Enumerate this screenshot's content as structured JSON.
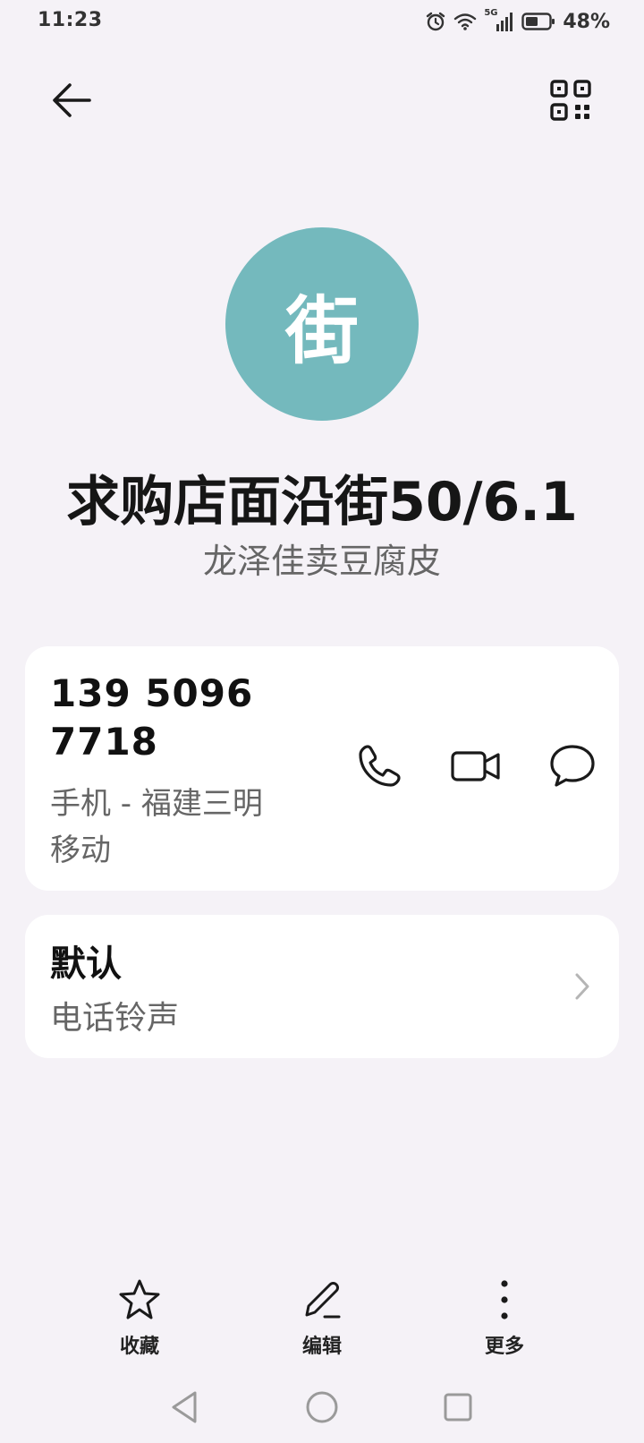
{
  "status_bar": {
    "time": "11:23",
    "network": "5G",
    "battery": "48%"
  },
  "contact": {
    "avatar_letter": "街",
    "name": "求购店面沿街50/6.1",
    "organization": "龙泽佳卖豆腐皮",
    "avatar_color": "#74b9bd"
  },
  "phone": {
    "number_line1": "139 5096",
    "number_line2": "7718",
    "description_line1": "手机 - 福建三明",
    "description_line2": "移动"
  },
  "ringtone": {
    "title": "默认",
    "subtitle": "电话铃声"
  },
  "bottom_actions": {
    "favorite": "收藏",
    "edit": "编辑",
    "more": "更多"
  },
  "icons": [
    "back-arrow-icon",
    "qr-code-icon",
    "phone-icon",
    "video-call-icon",
    "message-icon",
    "chevron-right-icon",
    "star-icon",
    "pencil-icon",
    "more-vertical-icon"
  ]
}
